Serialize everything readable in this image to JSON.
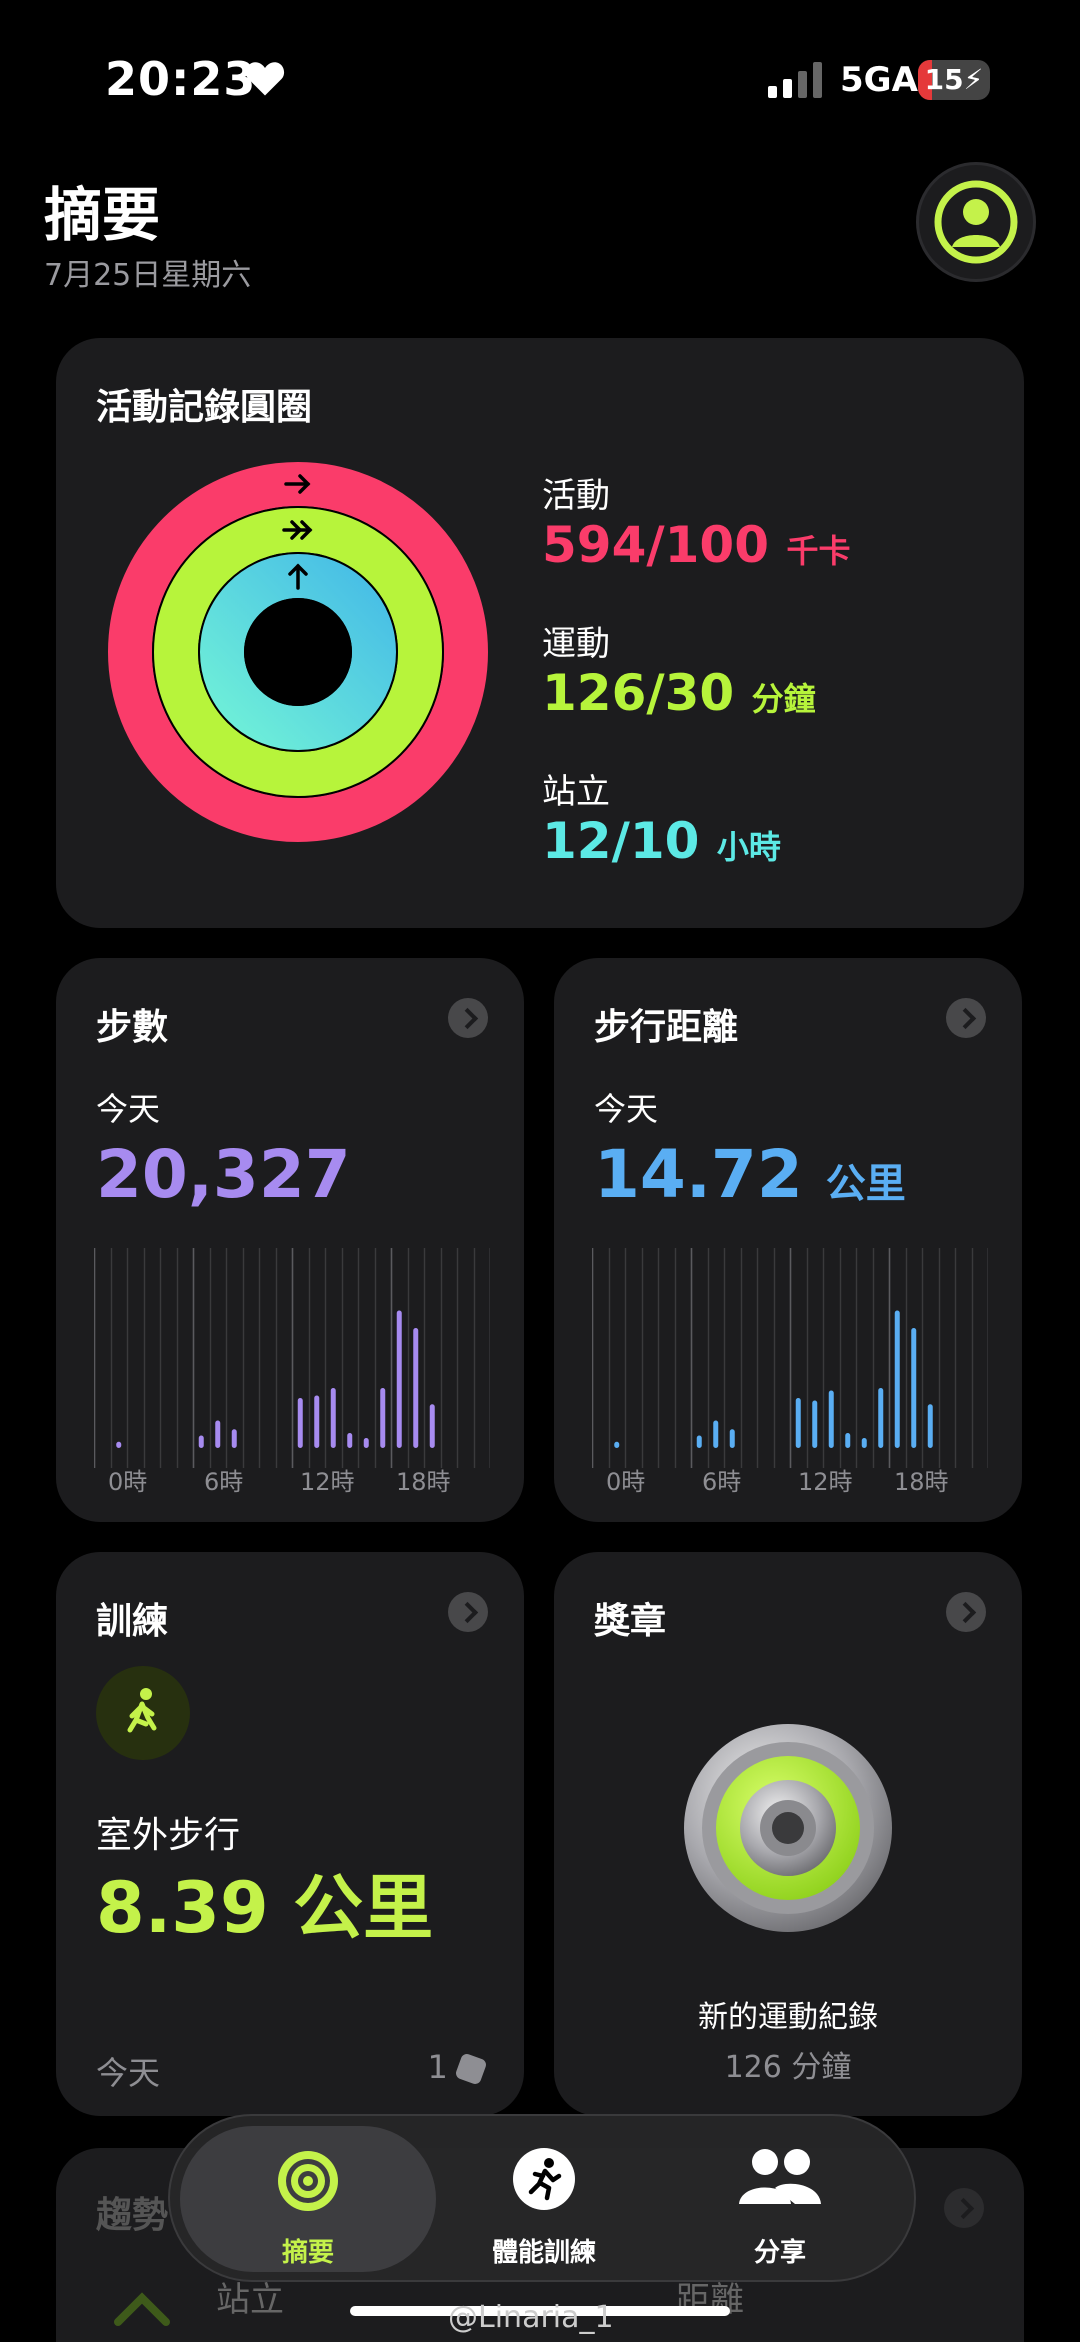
{
  "status": {
    "time": "20:23",
    "network": "5GA",
    "battery": "15"
  },
  "header": {
    "title": "摘要",
    "date": "7月25日星期六"
  },
  "rings": {
    "title": "活動記錄圓圈",
    "move": {
      "label": "活動",
      "value": "594/100",
      "unit": "千卡",
      "color": "#fa3c6a",
      "progress": 5.94
    },
    "exercise": {
      "label": "運動",
      "value": "126/30",
      "unit": "分鐘",
      "color": "#b7f43b",
      "progress": 4.2
    },
    "stand": {
      "label": "站立",
      "value": "12/10",
      "unit": "小時",
      "color": "#5ce9e5",
      "progress": 1.2
    }
  },
  "steps": {
    "title": "步數",
    "label": "今天",
    "value": "20,327",
    "color": "#a78bf0",
    "ticks": [
      "0時",
      "6時",
      "12時",
      "18時"
    ]
  },
  "distance": {
    "title": "步行距離",
    "label": "今天",
    "value": "14.72",
    "unit": "公里",
    "color": "#5aaef3",
    "ticks": [
      "0時",
      "6時",
      "12時",
      "18時"
    ]
  },
  "chart_data": [
    {
      "type": "bar",
      "categories": [
        "0",
        "1",
        "2",
        "3",
        "4",
        "5",
        "6",
        "7",
        "8",
        "9",
        "10",
        "11",
        "12",
        "13",
        "14",
        "15",
        "16",
        "17",
        "18",
        "19",
        "20",
        "21",
        "22",
        "23"
      ],
      "values": [
        0,
        5,
        0,
        0,
        0,
        0,
        10,
        22,
        15,
        0,
        0,
        0,
        40,
        42,
        48,
        12,
        8,
        48,
        110,
        96,
        35,
        0,
        0,
        0
      ],
      "xlabel": "",
      "ylabel": ""
    },
    {
      "type": "bar",
      "categories": [
        "0",
        "1",
        "2",
        "3",
        "4",
        "5",
        "6",
        "7",
        "8",
        "9",
        "10",
        "11",
        "12",
        "13",
        "14",
        "15",
        "16",
        "17",
        "18",
        "19",
        "20",
        "21",
        "22",
        "23"
      ],
      "values": [
        0,
        5,
        0,
        0,
        0,
        0,
        10,
        22,
        15,
        0,
        0,
        0,
        40,
        38,
        46,
        12,
        8,
        48,
        110,
        96,
        35,
        0,
        0,
        0
      ],
      "xlabel": "",
      "ylabel": ""
    }
  ],
  "workout": {
    "title": "訓練",
    "name": "室外步行",
    "value": "8.39 公里",
    "footer_left": "今天",
    "footer_right": "1"
  },
  "awards": {
    "title": "獎章",
    "award_name": "新的運動紀錄",
    "award_value": "126 分鐘"
  },
  "trends": {
    "title": "趨勢",
    "stand": "站立",
    "distance": "距離"
  },
  "tabbar": {
    "tabs": [
      {
        "label": "摘要",
        "icon": "summary-rings-icon",
        "active": true
      },
      {
        "label": "體能訓練",
        "icon": "fitness-plus-icon",
        "active": false
      },
      {
        "label": "分享",
        "icon": "sharing-people-icon",
        "active": false
      }
    ]
  },
  "watermark": "@Linaria_1"
}
